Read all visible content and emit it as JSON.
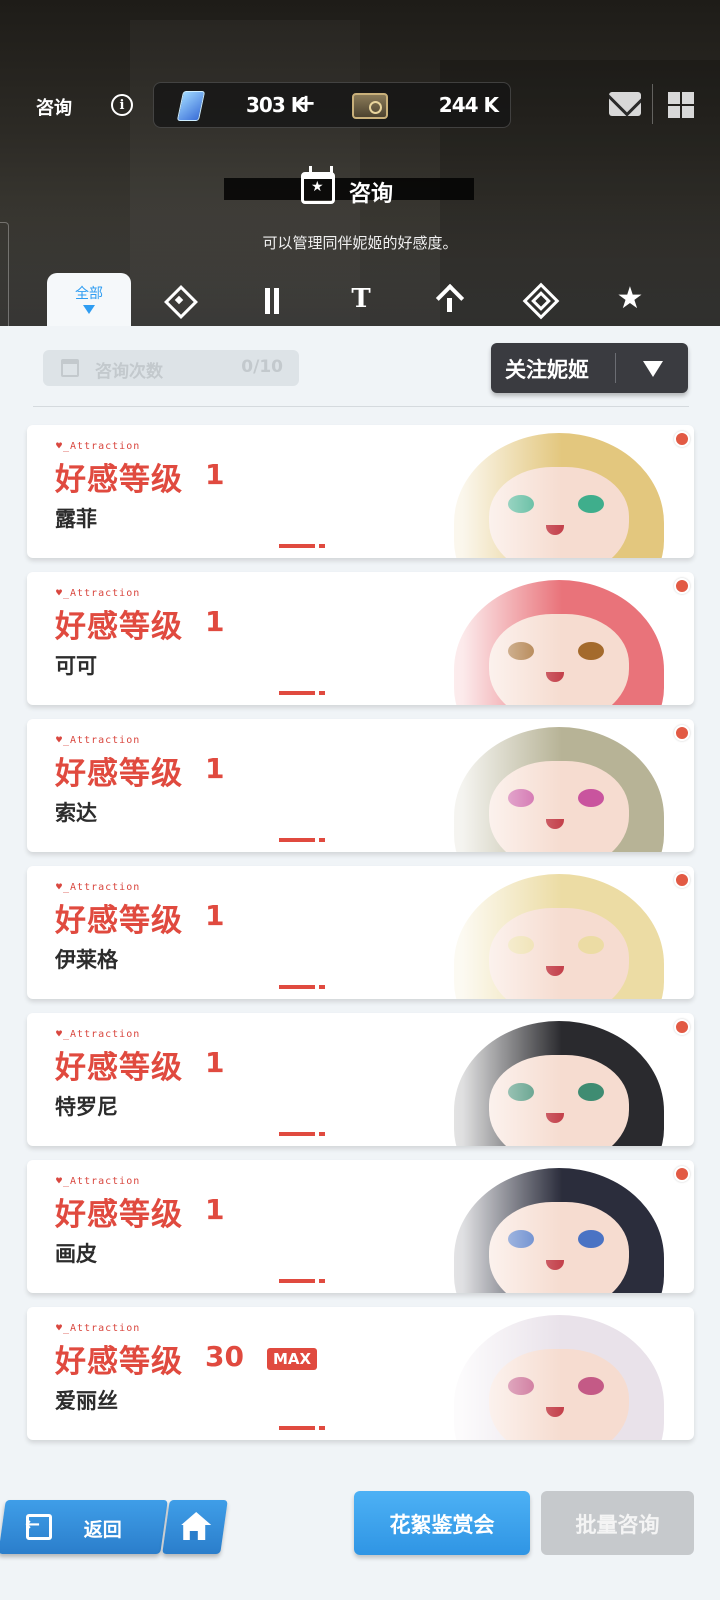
{
  "header": {
    "title": "咨询",
    "info_icon_glyph": "i",
    "gems": {
      "icon": "gem-icon",
      "amount": "303 K",
      "plus": "+"
    },
    "credits": {
      "icon": "credit-icon",
      "amount": "244 K"
    },
    "section_title": "咨询",
    "section_subtitle": "可以管理同伴妮姬的好感度。"
  },
  "tabs": [
    {
      "label": "全部",
      "icon": "all-tab",
      "active": true
    },
    {
      "icon": "diamond-icon"
    },
    {
      "icon": "twin-bar-icon"
    },
    {
      "icon": "t-icon",
      "glyph": "T"
    },
    {
      "icon": "arrow-up-icon"
    },
    {
      "icon": "nested-diamond-icon"
    },
    {
      "icon": "star-icon",
      "glyph": "★"
    }
  ],
  "toolbar": {
    "consult_count_label": "咨询次数",
    "consult_count_value": "0/10",
    "follow_dropdown_label": "关注妮姬"
  },
  "cards": [
    {
      "attraction_tag": "♥_Attraction",
      "level_label": "好感等级",
      "level": "1",
      "name": "露菲",
      "max": "",
      "has_notification": true,
      "hair_color": "#e3c77e",
      "eye_color": "#3fae8c"
    },
    {
      "attraction_tag": "♥_Attraction",
      "level_label": "好感等级",
      "level": "1",
      "name": "可可",
      "max": "",
      "has_notification": true,
      "hair_color": "#e9737a",
      "eye_color": "#a46a2c"
    },
    {
      "attraction_tag": "♥_Attraction",
      "level_label": "好感等级",
      "level": "1",
      "name": "索达",
      "max": "",
      "has_notification": true,
      "hair_color": "#b7b396",
      "eye_color": "#c9549e"
    },
    {
      "attraction_tag": "♥_Attraction",
      "level_label": "好感等级",
      "level": "1",
      "name": "伊莱格",
      "max": "",
      "has_notification": true,
      "hair_color": "#ecdca4",
      "eye_color": "#ecdca4"
    },
    {
      "attraction_tag": "♥_Attraction",
      "level_label": "好感等级",
      "level": "1",
      "name": "特罗尼",
      "max": "",
      "has_notification": true,
      "hair_color": "#2a2a2e",
      "eye_color": "#3f8c72"
    },
    {
      "attraction_tag": "♥_Attraction",
      "level_label": "好感等级",
      "level": "1",
      "name": "画皮",
      "max": "",
      "has_notification": true,
      "hair_color": "#2b2d3c",
      "eye_color": "#4a73c4"
    },
    {
      "attraction_tag": "♥_Attraction",
      "level_label": "好感等级",
      "level": "30",
      "name": "爱丽丝",
      "max": "MAX",
      "has_notification": false,
      "hair_color": "#e9e2ea",
      "eye_color": "#c45a86"
    }
  ],
  "footer": {
    "back_label": "返回",
    "home_icon": "home-icon",
    "gallery_label": "花絮鉴赏会",
    "batch_consult_label": "批量咨询"
  },
  "colors": {
    "accent_red": "#e04a3f",
    "accent_blue": "#2f9df2",
    "notification_dot": "#e25a44",
    "disabled_gray": "#c6c9cc"
  }
}
